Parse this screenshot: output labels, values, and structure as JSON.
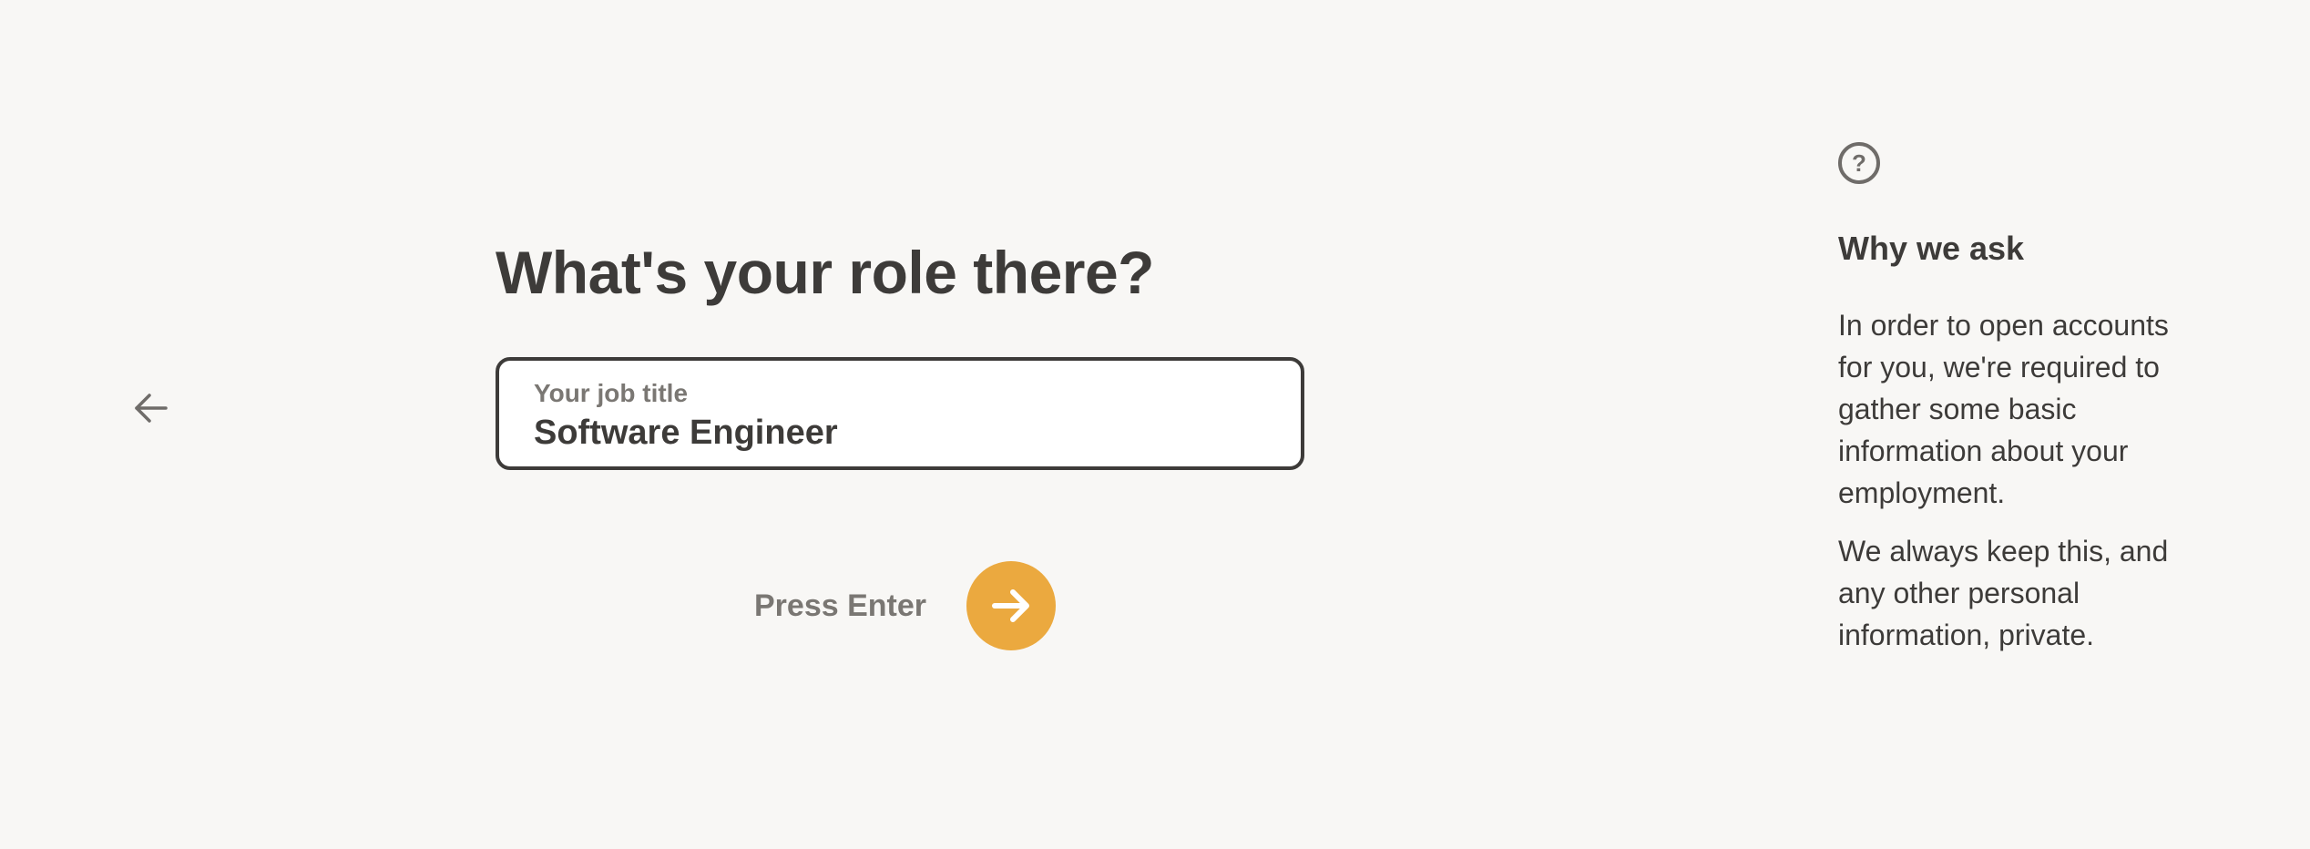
{
  "navigation": {
    "back_icon": "arrow-left-icon"
  },
  "form": {
    "title": "What's your role there?",
    "field": {
      "label": "Your job title",
      "value": "Software Engineer"
    },
    "submit": {
      "hint": "Press Enter",
      "icon": "arrow-right-icon"
    }
  },
  "help": {
    "icon": "question-circle-icon",
    "icon_glyph": "?",
    "heading": "Why we ask",
    "paragraphs": [
      "In order to open accounts for you, we're required to gather some basic information about your employment.",
      "We always keep this, and any other personal information, private."
    ]
  },
  "colors": {
    "background": "#f8f7f5",
    "text": "#3d3b39",
    "muted": "#7a7773",
    "accent": "#eba93f"
  }
}
